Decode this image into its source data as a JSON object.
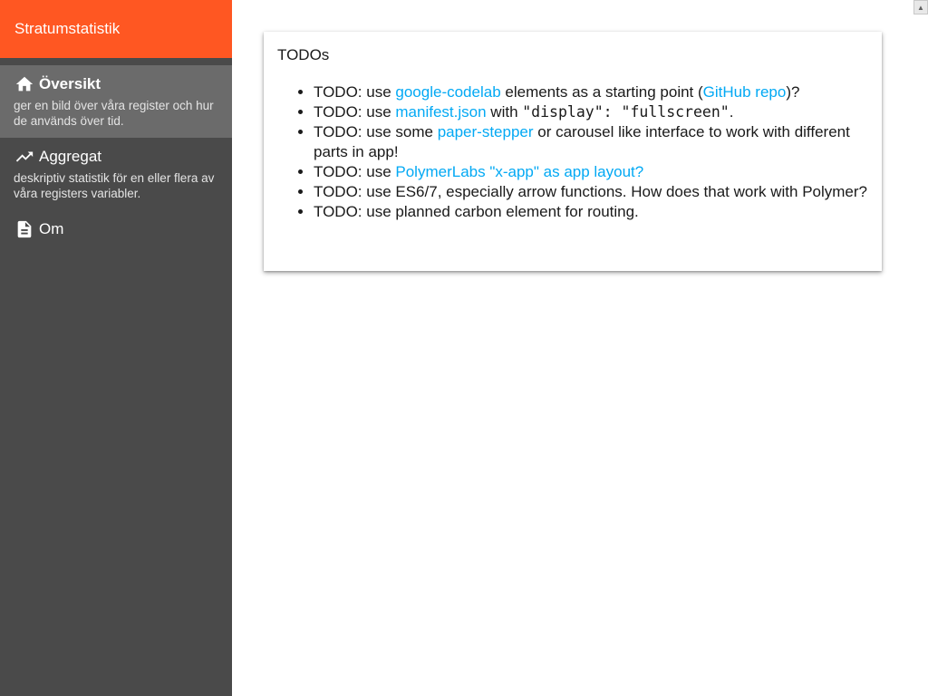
{
  "app": {
    "title": "Stratumstatistik",
    "accent_color": "#ff5722",
    "sidebar_color": "#4a4a4a",
    "link_color": "#03a9f4"
  },
  "sidebar": {
    "items": [
      {
        "icon": "home-icon",
        "label": "Översikt",
        "description": "ger en bild över våra register och hur de används över tid.",
        "active": true
      },
      {
        "icon": "trending-up-icon",
        "label": "Aggregat",
        "description": "deskriptiv statistik för en eller flera av våra registers variabler."
      },
      {
        "icon": "document-icon",
        "label": "Om",
        "description": ""
      }
    ]
  },
  "card": {
    "title": "TODOs",
    "items": [
      {
        "prefix": "TODO: use ",
        "link1": "google-codelab",
        "mid": " elements as a starting point (",
        "link2": "GitHub repo",
        "suffix": ")?"
      },
      {
        "prefix": "TODO: use ",
        "link1": "manifest.json",
        "mid": " with ",
        "code": "\"display\": \"fullscreen\"",
        "suffix": "."
      },
      {
        "prefix": "TODO: use some ",
        "link1": "paper-stepper",
        "suffix": " or carousel like interface to work with different parts in app!"
      },
      {
        "prefix": "TODO: use ",
        "link1": "PolymerLabs \"x-app\" as app layout?"
      },
      {
        "text": "TODO: use ES6/7, especially arrow functions. How does that work with Polymer?"
      },
      {
        "text": "TODO: use planned carbon element for routing."
      }
    ]
  },
  "scrollbar": {
    "up_arrow": "▲"
  }
}
